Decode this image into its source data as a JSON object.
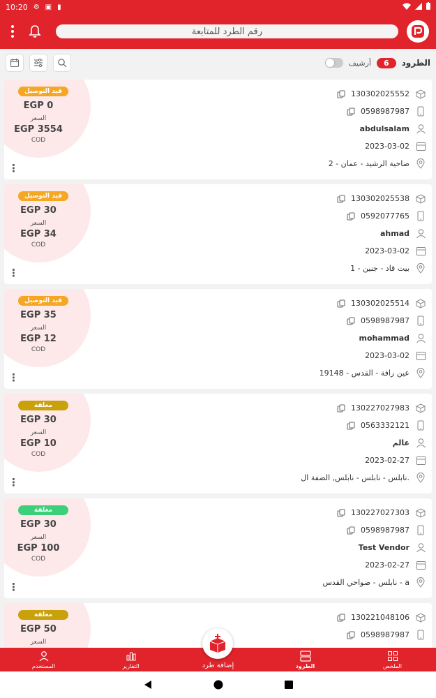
{
  "status_bar": {
    "time": "10:20"
  },
  "header": {
    "search_placeholder": "رقم الطرد للمتابعة"
  },
  "toolbar": {
    "title": "الطرود",
    "count": "6",
    "archive_label": "أرشيف"
  },
  "colors": {
    "brand": "#e1232b",
    "in_delivery": "#f5a623",
    "closed_olive": "#c9a10a",
    "closed_green": "#3dd07a"
  },
  "parcels": [
    {
      "status": "قيد التوصيل",
      "status_color": "#f5a623",
      "cost": "EGP 0",
      "price_label": "السعر",
      "cod_amount": "EGP 3554",
      "cod_label": "COD",
      "tracking": "130302025552",
      "phone": "0598987987",
      "name": "abdulsalam",
      "date": "2023-03-02",
      "address": "ضاحية الرشيد - عمان - 2"
    },
    {
      "status": "قيد التوصيل",
      "status_color": "#f5a623",
      "cost": "EGP 30",
      "price_label": "السعر",
      "cod_amount": "EGP 34",
      "cod_label": "COD",
      "tracking": "130302025538",
      "phone": "0592077765",
      "name": "ahmad",
      "date": "2023-03-02",
      "address": "بيت قاد - جنين - 1"
    },
    {
      "status": "قيد التوصيل",
      "status_color": "#f5a623",
      "cost": "EGP 35",
      "price_label": "السعر",
      "cod_amount": "EGP 12",
      "cod_label": "COD",
      "tracking": "130302025514",
      "phone": "0598987987",
      "name": "mohammad",
      "date": "2023-03-02",
      "address": "عين رافة - القدس - 19148"
    },
    {
      "status": "مغلقة",
      "status_color": "#c9a10a",
      "cost": "EGP 30",
      "price_label": "السعر",
      "cod_amount": "EGP 10",
      "cod_label": "COD",
      "tracking": "130227027983",
      "phone": "0563332121",
      "name": "عالم",
      "date": "2023-02-27",
      "address": "نابلس - نابلس - نابلس, الضفة ال."
    },
    {
      "status": "مغلقة",
      "status_color": "#3dd07a",
      "cost": "EGP 30",
      "price_label": "السعر",
      "cod_amount": "EGP 100",
      "cod_label": "COD",
      "tracking": "130227027303",
      "phone": "0598987987",
      "name": "Test Vendor",
      "date": "2023-02-27",
      "address": "نابلس - ضواحي القدس - a"
    },
    {
      "status": "مغلقة",
      "status_color": "#c9a10a",
      "cost": "EGP 50",
      "price_label": "السعر",
      "cod_amount": "",
      "cod_label": "",
      "tracking": "130221048106",
      "phone": "0598987987",
      "name": "",
      "date": "",
      "address": ""
    }
  ],
  "bottom_nav": {
    "user": "المستخدم",
    "reports": "التقارير",
    "add_parcel": "إضافة طرد",
    "parcels": "الطرود",
    "summary": "الملخص"
  }
}
